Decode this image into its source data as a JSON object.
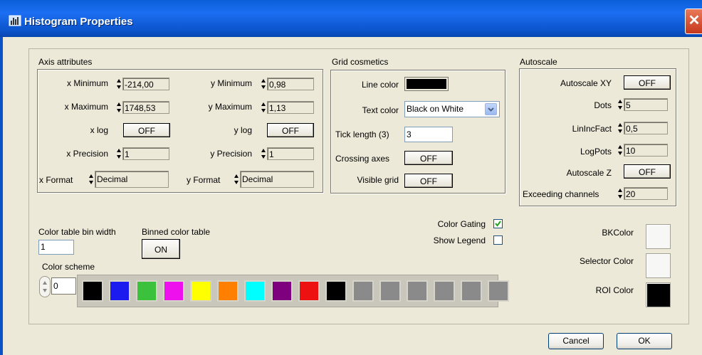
{
  "window": {
    "title": "Histogram Properties",
    "close_glyph": "✕"
  },
  "axis": {
    "group_title": "Axis attributes",
    "x_min_label": "x Minimum",
    "x_min_value": "-214,00",
    "x_max_label": "x Maximum",
    "x_max_value": "1748,53",
    "x_log_label": "x log",
    "x_log_value": "OFF",
    "x_precision_label": "x Precision",
    "x_precision_value": "1",
    "x_format_label": "x Format",
    "x_format_value": "Decimal",
    "y_min_label": "y Minimum",
    "y_min_value": "0,98",
    "y_max_label": "y Maximum",
    "y_max_value": "1,13",
    "y_log_label": "y log",
    "y_log_value": "OFF",
    "y_precision_label": "y Precision",
    "y_precision_value": "1",
    "y_format_label": "y Format",
    "y_format_value": "Decimal"
  },
  "grid": {
    "group_title": "Grid cosmetics",
    "line_color_label": "Line color",
    "line_color": "#000000",
    "text_color_label": "Text color",
    "text_color_value": "Black on White",
    "tick_length_label": "Tick length (3)",
    "tick_length_value": "3",
    "crossing_axes_label": "Crossing axes",
    "crossing_axes_value": "OFF",
    "visible_grid_label": "Visible grid",
    "visible_grid_value": "OFF"
  },
  "autoscale": {
    "group_title": "Autoscale",
    "xy_label": "Autoscale XY",
    "xy_value": "OFF",
    "dots_label": "Dots",
    "dots_value": "5",
    "lininc_label": "LinIncFact",
    "lininc_value": "0,5",
    "logpots_label": "LogPots",
    "logpots_value": "10",
    "z_label": "Autoscale Z",
    "z_value": "OFF",
    "exceeding_label": "Exceeding channels",
    "exceeding_value": "20"
  },
  "colortable": {
    "bin_width_label": "Color table bin width",
    "bin_width_value": "1",
    "binned_label": "Binned color table",
    "binned_value": "ON",
    "scheme_label": "Color scheme",
    "scheme_value": "0",
    "swatches": [
      "#000000",
      "#1b1bf0",
      "#3cc13c",
      "#ee11ee",
      "#ffff00",
      "#ff7f00",
      "#00ffff",
      "#7f007f",
      "#ee1111",
      "#000000",
      "#8a8a8a",
      "#8a8a8a",
      "#8a8a8a",
      "#8a8a8a",
      "#8a8a8a",
      "#8a8a8a"
    ]
  },
  "options": {
    "color_gating_label": "Color Gating",
    "color_gating_checked": true,
    "show_legend_label": "Show Legend",
    "show_legend_checked": false,
    "bkcolor_label": "BKColor",
    "bkcolor": "#f7f7f5",
    "selector_color_label": "Selector Color",
    "selector_color": "#f7f7f5",
    "roi_color_label": "ROI Color",
    "roi_color": "#000000"
  },
  "footer": {
    "cancel_label": "Cancel",
    "ok_label": "OK"
  }
}
